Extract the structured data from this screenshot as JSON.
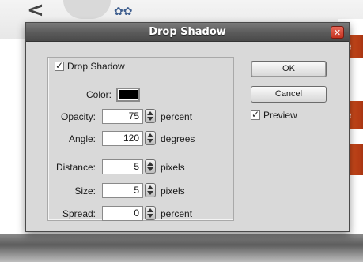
{
  "dialog": {
    "title": "Drop Shadow",
    "close_icon": "close-icon"
  },
  "background": {
    "tab_letters": [
      "e",
      "e",
      "s"
    ],
    "lt_glyph": "<",
    "bugs_glyph": "✿✿"
  },
  "drop_shadow": {
    "checkbox_label": "Drop Shadow",
    "checked": true,
    "color_label": "Color:",
    "color_value": "#000000"
  },
  "fields": {
    "opacity": {
      "label": "Opacity:",
      "value": "75",
      "unit": "percent"
    },
    "angle": {
      "label": "Angle:",
      "value": "120",
      "unit": "degrees"
    },
    "distance": {
      "label": "Distance:",
      "value": "5",
      "unit": "pixels"
    },
    "size": {
      "label": "Size:",
      "value": "5",
      "unit": "pixels"
    },
    "spread": {
      "label": "Spread:",
      "value": "0",
      "unit": "percent"
    }
  },
  "buttons": {
    "ok_label": "OK",
    "cancel_label": "Cancel"
  },
  "preview": {
    "label": "Preview",
    "checked": true
  },
  "colors": {
    "title_bar": "#5a5a5a",
    "dialog_bg": "#d9d9d9",
    "close_red": "#c2321f",
    "tab_red": "#c6471a"
  }
}
